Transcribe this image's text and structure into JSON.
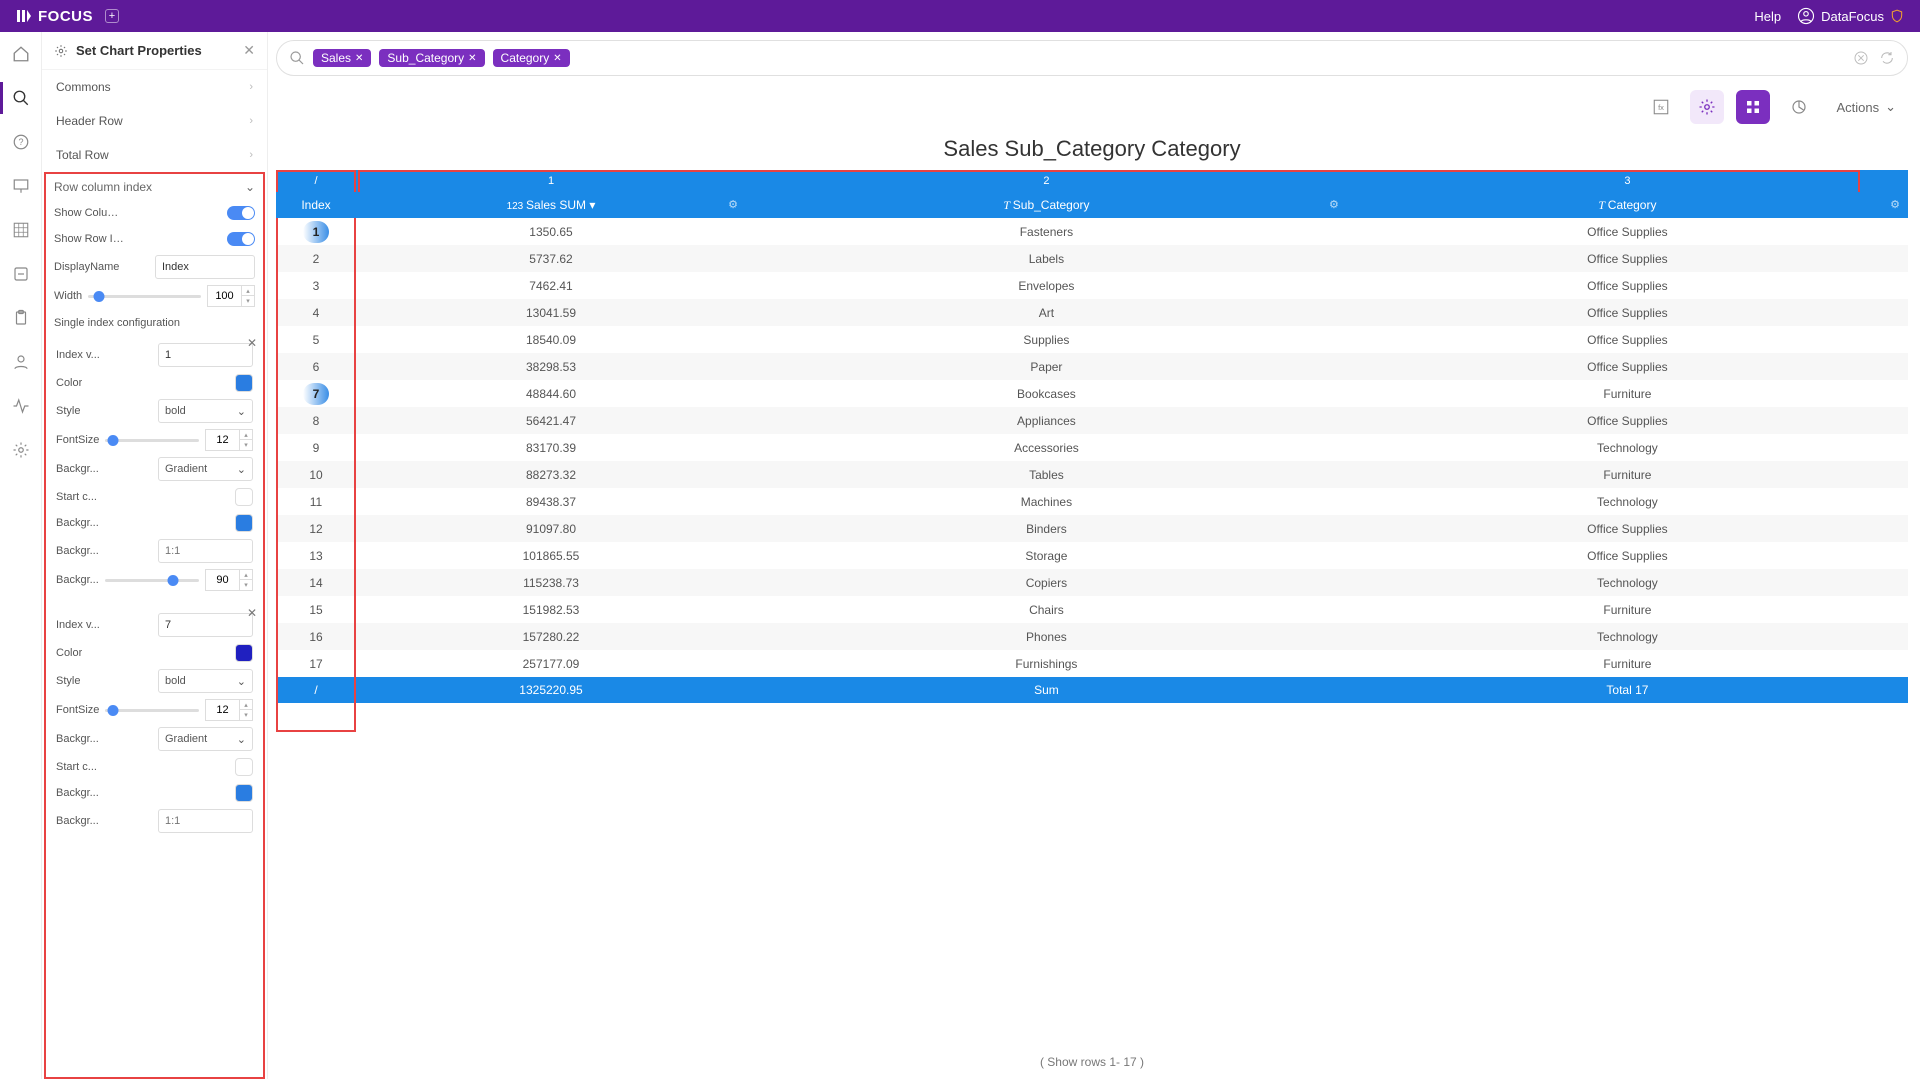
{
  "topbar": {
    "brand": "FOCUS",
    "help": "Help",
    "user": "DataFocus"
  },
  "props": {
    "title": "Set Chart Properties",
    "sections": {
      "commons": "Commons",
      "header": "Header Row",
      "total": "Total Row"
    },
    "row_col_index": "Row column index",
    "show_column": "Show Column...",
    "show_row": "Show Row In...",
    "display_name_label": "DisplayName",
    "display_name_value": "Index",
    "width_label": "Width",
    "width_value": "100",
    "single_index": "Single index configuration",
    "cfg1": {
      "index_v_label": "Index v...",
      "index_v": "1",
      "color_label": "Color",
      "style_label": "Style",
      "style": "bold",
      "fontsize_label": "FontSize",
      "fontsize": "12",
      "bg_label": "Backgr...",
      "bg": "Gradient",
      "start_c_label": "Start c...",
      "bg2_label": "Backgr...",
      "bg3_label": "Backgr...",
      "bg3_val": "1:1",
      "bg4_label": "Backgr...",
      "bg4_val": "90"
    },
    "cfg2": {
      "index_v_label": "Index v...",
      "index_v": "7",
      "color_label": "Color",
      "style_label": "Style",
      "style": "bold",
      "fontsize_label": "FontSize",
      "fontsize": "12",
      "bg_label": "Backgr...",
      "bg": "Gradient",
      "start_c_label": "Start c...",
      "bg2_label": "Backgr...",
      "bg3_label": "Backgr...",
      "bg3_val": "1:1"
    }
  },
  "search": {
    "pills": [
      "Sales",
      "Sub_Category",
      "Category"
    ]
  },
  "toolbar": {
    "actions": "Actions"
  },
  "chart_title": "Sales Sub_Category Category",
  "table": {
    "num_headers": [
      "/",
      "1",
      "2",
      "3"
    ],
    "headers": {
      "index": "Index",
      "sales": "Sales SUM",
      "sub": "Sub_Category",
      "cat": "Category"
    },
    "rows": [
      {
        "i": "1",
        "sales": "1350.65",
        "sub": "Fasteners",
        "cat": "Office Supplies",
        "badge": true
      },
      {
        "i": "2",
        "sales": "5737.62",
        "sub": "Labels",
        "cat": "Office Supplies"
      },
      {
        "i": "3",
        "sales": "7462.41",
        "sub": "Envelopes",
        "cat": "Office Supplies"
      },
      {
        "i": "4",
        "sales": "13041.59",
        "sub": "Art",
        "cat": "Office Supplies"
      },
      {
        "i": "5",
        "sales": "18540.09",
        "sub": "Supplies",
        "cat": "Office Supplies"
      },
      {
        "i": "6",
        "sales": "38298.53",
        "sub": "Paper",
        "cat": "Office Supplies"
      },
      {
        "i": "7",
        "sales": "48844.60",
        "sub": "Bookcases",
        "cat": "Furniture",
        "badge": true
      },
      {
        "i": "8",
        "sales": "56421.47",
        "sub": "Appliances",
        "cat": "Office Supplies"
      },
      {
        "i": "9",
        "sales": "83170.39",
        "sub": "Accessories",
        "cat": "Technology"
      },
      {
        "i": "10",
        "sales": "88273.32",
        "sub": "Tables",
        "cat": "Furniture"
      },
      {
        "i": "11",
        "sales": "89438.37",
        "sub": "Machines",
        "cat": "Technology"
      },
      {
        "i": "12",
        "sales": "91097.80",
        "sub": "Binders",
        "cat": "Office Supplies"
      },
      {
        "i": "13",
        "sales": "101865.55",
        "sub": "Storage",
        "cat": "Office Supplies"
      },
      {
        "i": "14",
        "sales": "115238.73",
        "sub": "Copiers",
        "cat": "Technology"
      },
      {
        "i": "15",
        "sales": "151982.53",
        "sub": "Chairs",
        "cat": "Furniture"
      },
      {
        "i": "16",
        "sales": "157280.22",
        "sub": "Phones",
        "cat": "Technology"
      },
      {
        "i": "17",
        "sales": "257177.09",
        "sub": "Furnishings",
        "cat": "Furniture"
      }
    ],
    "footer": {
      "slash": "/",
      "sales": "1325220.95",
      "sum": "Sum",
      "total": "Total 17"
    }
  },
  "footer_note": "( Show rows 1- 17 )",
  "chart_data": {
    "type": "table",
    "title": "Sales Sub_Category Category",
    "columns": [
      "Index",
      "Sales SUM",
      "Sub_Category",
      "Category"
    ],
    "rows": [
      [
        1,
        1350.65,
        "Fasteners",
        "Office Supplies"
      ],
      [
        2,
        5737.62,
        "Labels",
        "Office Supplies"
      ],
      [
        3,
        7462.41,
        "Envelopes",
        "Office Supplies"
      ],
      [
        4,
        13041.59,
        "Art",
        "Office Supplies"
      ],
      [
        5,
        18540.09,
        "Supplies",
        "Office Supplies"
      ],
      [
        6,
        38298.53,
        "Paper",
        "Office Supplies"
      ],
      [
        7,
        48844.6,
        "Bookcases",
        "Furniture"
      ],
      [
        8,
        56421.47,
        "Appliances",
        "Office Supplies"
      ],
      [
        9,
        83170.39,
        "Accessories",
        "Technology"
      ],
      [
        10,
        88273.32,
        "Tables",
        "Furniture"
      ],
      [
        11,
        89438.37,
        "Machines",
        "Technology"
      ],
      [
        12,
        91097.8,
        "Binders",
        "Office Supplies"
      ],
      [
        13,
        101865.55,
        "Storage",
        "Office Supplies"
      ],
      [
        14,
        115238.73,
        "Copiers",
        "Technology"
      ],
      [
        15,
        151982.53,
        "Chairs",
        "Furniture"
      ],
      [
        16,
        157280.22,
        "Phones",
        "Technology"
      ],
      [
        17,
        257177.09,
        "Furnishings",
        "Furniture"
      ]
    ],
    "totals": {
      "Sales SUM": 1325220.95,
      "count": 17
    }
  }
}
